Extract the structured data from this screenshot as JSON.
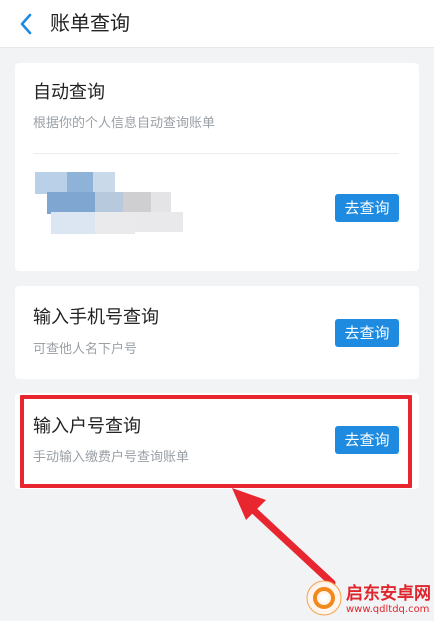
{
  "header": {
    "back_icon": "chevron-left-icon",
    "title": "账单查询"
  },
  "cards": {
    "auto": {
      "title": "自动查询",
      "subtitle": "根据你的个人信息自动查询账单",
      "button": "去查询"
    },
    "phone": {
      "title": "输入手机号查询",
      "subtitle": "可查他人名下户号",
      "button": "去查询"
    },
    "account": {
      "title": "输入户号查询",
      "subtitle": "手动输入缴费户号查询账单",
      "button": "去查询"
    }
  },
  "colors": {
    "accent": "#1e8be0",
    "highlight": "#e8262f"
  },
  "watermark": {
    "text": "启东安卓网",
    "url": "www.qdltdq.com"
  }
}
